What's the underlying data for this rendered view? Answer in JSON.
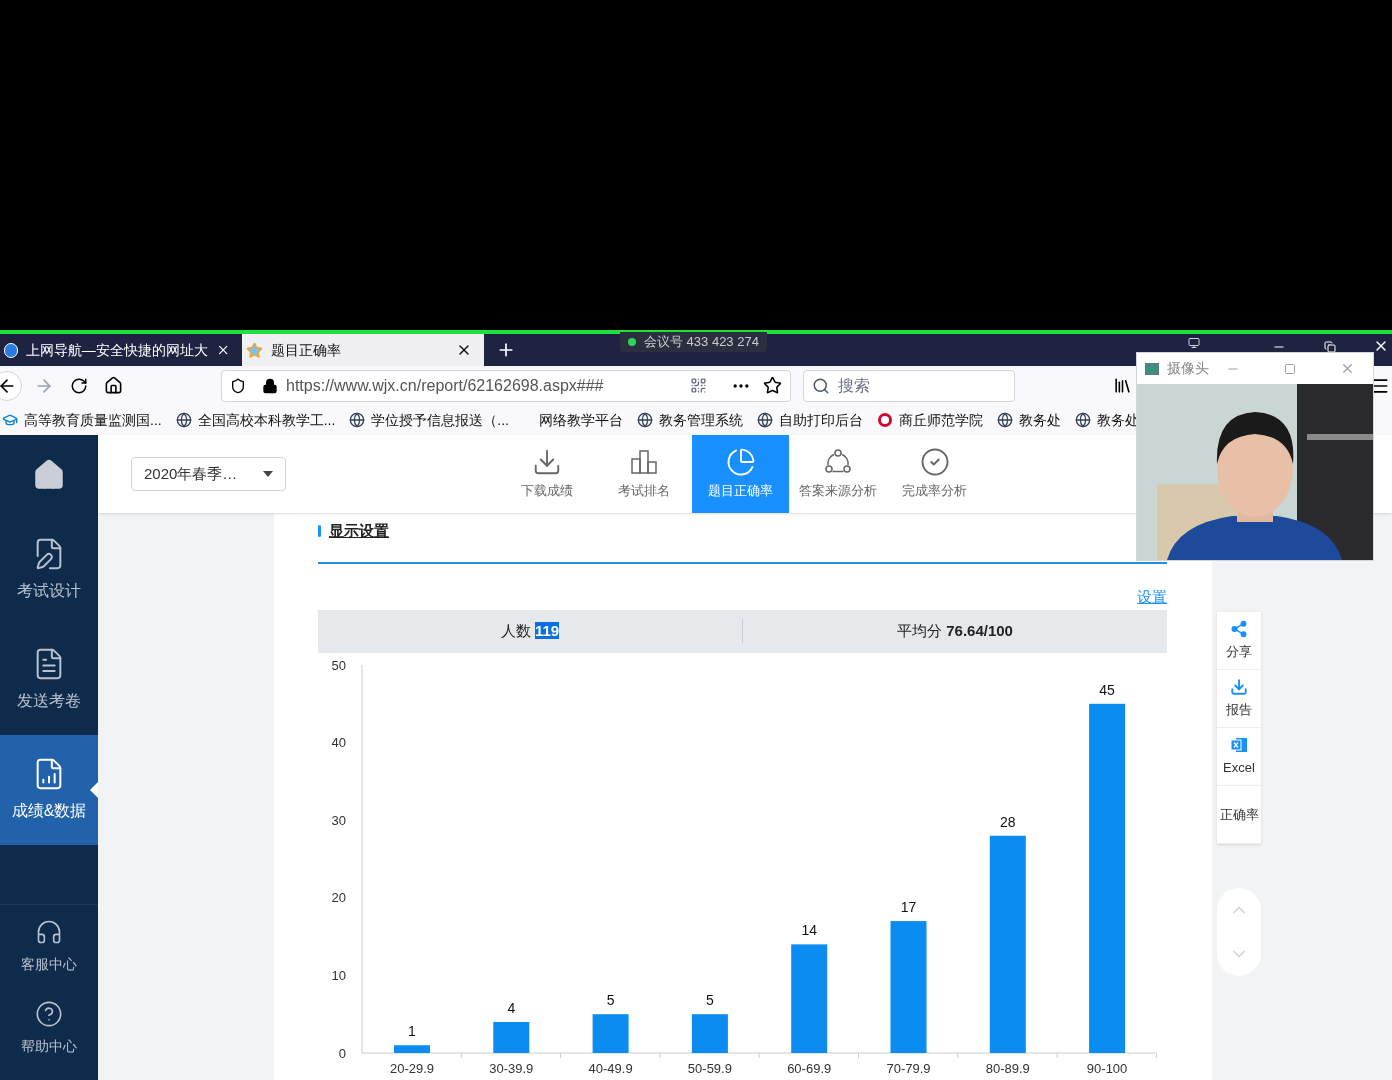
{
  "browser": {
    "tabs": [
      {
        "title": "上网导航—安全快捷的网址大",
        "selected": false
      },
      {
        "title": "题目正确率",
        "selected": true
      }
    ],
    "meeting": "会议号 433 423 274",
    "address": "https://www.wjx.cn/report/62162698.aspx###",
    "search": {
      "placeholder": "搜索"
    },
    "bookmarks": [
      {
        "label": "高等教育质量监测国...",
        "kind": "cap"
      },
      {
        "label": "全国高校本科教学工...",
        "kind": "globe"
      },
      {
        "label": "学位授予信息报送（...",
        "kind": "globe"
      },
      {
        "label": "网络教学平台",
        "kind": "plain"
      },
      {
        "label": "教务管理系统",
        "kind": "globe"
      },
      {
        "label": "自助打印后台",
        "kind": "globe"
      },
      {
        "label": "商丘师范学院",
        "kind": "seal"
      },
      {
        "label": "教务处",
        "kind": "globe"
      },
      {
        "label": "教务处",
        "kind": "globe"
      }
    ]
  },
  "camera_window": {
    "title": "摄像头"
  },
  "sidebar": {
    "items": [
      {
        "kind": "home",
        "selected": false
      },
      {
        "kind": "design",
        "label": "考试设计",
        "selected": false
      },
      {
        "kind": "send",
        "label": "发送考卷",
        "selected": false
      },
      {
        "kind": "data",
        "label": "成绩&数据",
        "selected": true
      },
      {
        "kind": "support",
        "label": "客服中心",
        "selected": false
      },
      {
        "kind": "help",
        "label": "帮助中心",
        "selected": false
      }
    ]
  },
  "header": {
    "dropdown": "2020年春季…",
    "tabs": [
      {
        "label": "下载成绩",
        "kind": "download",
        "selected": false
      },
      {
        "label": "考试排名",
        "kind": "ranking",
        "selected": false
      },
      {
        "label": "题目正确率",
        "kind": "pie",
        "selected": true
      },
      {
        "label": "答案来源分析",
        "kind": "share",
        "selected": false
      },
      {
        "label": "完成率分析",
        "kind": "check",
        "selected": false
      }
    ]
  },
  "section_title": "显示设置",
  "settings_link": "设置",
  "summary": {
    "count_label": "人数",
    "count": "119",
    "average_label": "平均分",
    "average": "76.64/100"
  },
  "chart_data": {
    "type": "bar",
    "categories": [
      "20-29.9",
      "30-39.9",
      "40-49.9",
      "50-59.9",
      "60-69.9",
      "70-79.9",
      "80-89.9",
      "90-100"
    ],
    "values": [
      1,
      4,
      5,
      5,
      14,
      17,
      28,
      45
    ],
    "ylim": [
      0,
      50
    ],
    "yticks": [
      0,
      10,
      20,
      30,
      40,
      50
    ],
    "data_labels": true
  },
  "side_tools": [
    {
      "label": "分享",
      "kind": "share"
    },
    {
      "label": "报告",
      "kind": "download"
    },
    {
      "label": "Excel",
      "kind": "excel"
    },
    {
      "label": "正确率",
      "kind": "text"
    }
  ]
}
